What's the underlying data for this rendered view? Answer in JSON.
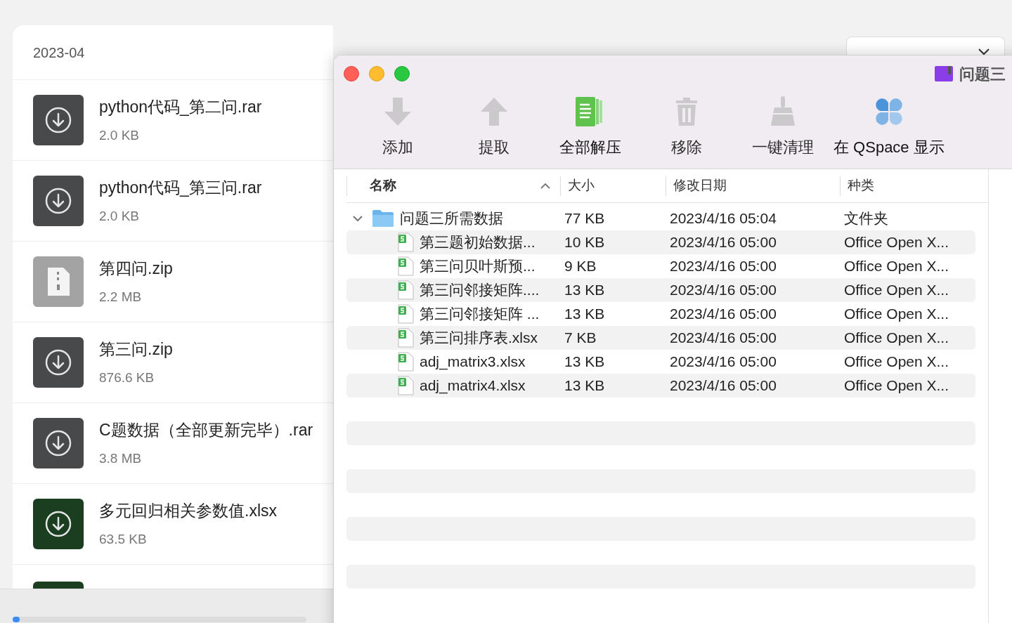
{
  "downloads": {
    "month": "2023-04",
    "items": [
      {
        "name": "python代码_第二问.rar",
        "size": "2.0 KB",
        "kind": "download"
      },
      {
        "name": "python代码_第三问.rar",
        "size": "2.0 KB",
        "kind": "download"
      },
      {
        "name": "第四问.zip",
        "size": "2.2 MB",
        "kind": "zip"
      },
      {
        "name": "第三问.zip",
        "size": "876.6 KB",
        "kind": "download"
      },
      {
        "name": "C题数据（全部更新完毕）.rar",
        "size": "3.8 MB",
        "kind": "download"
      },
      {
        "name": "多元回归相关参数值.xlsx",
        "size": "63.5 KB",
        "kind": "sheet"
      }
    ],
    "progress": {
      "level": 0.02
    }
  },
  "archive_window": {
    "title": "问题三",
    "toolbar": [
      {
        "label": "添加",
        "kind": "add",
        "disabled": true
      },
      {
        "label": "提取",
        "kind": "extract",
        "disabled": true
      },
      {
        "label": "全部解压",
        "kind": "extract_all",
        "disabled": false
      },
      {
        "label": "移除",
        "kind": "remove",
        "disabled": true
      },
      {
        "label": "一键清理",
        "kind": "clean",
        "disabled": true
      },
      {
        "label": "在 QSpace 显示",
        "kind": "qspace",
        "disabled": false
      }
    ],
    "columns": [
      {
        "label": "名称",
        "sorted": true
      },
      {
        "label": "大小",
        "sorted": false
      },
      {
        "label": "修改日期",
        "sorted": false
      },
      {
        "label": "种类",
        "sorted": false
      }
    ],
    "rows": [
      {
        "name": "问题三所需数据",
        "size": "77 KB",
        "date": "2023/4/16 05:04",
        "type": "文件夹",
        "kind": "folder",
        "expanded": true,
        "children": [
          {
            "name": "第三题初始数据...",
            "size": "10 KB",
            "date": "2023/4/16 05:00",
            "type": "Office Open X...",
            "kind": "sheet"
          },
          {
            "name": "第三问贝叶斯预...",
            "size": "9 KB",
            "date": "2023/4/16 05:00",
            "type": "Office Open X...",
            "kind": "sheet"
          },
          {
            "name": "第三问邻接矩阵....",
            "size": "13 KB",
            "date": "2023/4/16 05:00",
            "type": "Office Open X...",
            "kind": "sheet"
          },
          {
            "name": "第三问邻接矩阵 ...",
            "size": "13 KB",
            "date": "2023/4/16 05:00",
            "type": "Office Open X...",
            "kind": "sheet"
          },
          {
            "name": "第三问排序表.xlsx",
            "size": "7 KB",
            "date": "2023/4/16 05:00",
            "type": "Office Open X...",
            "kind": "sheet"
          },
          {
            "name": "adj_matrix3.xlsx",
            "size": "13 KB",
            "date": "2023/4/16 05:00",
            "type": "Office Open X...",
            "kind": "sheet"
          },
          {
            "name": "adj_matrix4.xlsx",
            "size": "13 KB",
            "date": "2023/4/16 05:00",
            "type": "Office Open X...",
            "kind": "sheet"
          }
        ]
      }
    ]
  }
}
